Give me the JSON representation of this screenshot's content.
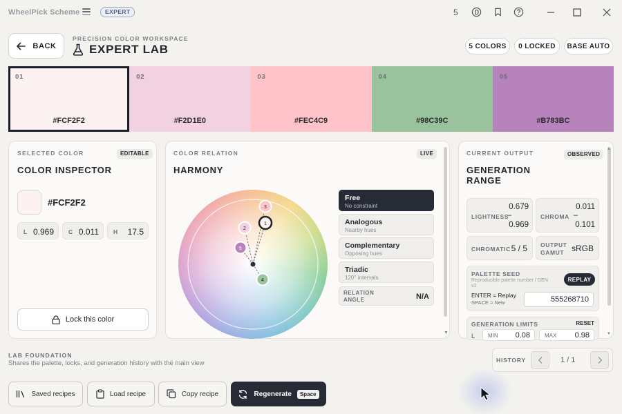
{
  "titlebar": {
    "app_name": "WheelPick Scheme",
    "mode_badge": "EXPERT",
    "counter": "5",
    "icons": [
      "menu-icon",
      "currency-icon",
      "bookmark-icon",
      "help-icon",
      "minimize-icon",
      "maximize-icon",
      "close-icon"
    ]
  },
  "header": {
    "back_label": "BACK",
    "kicker": "PRECISION COLOR WORKSPACE",
    "title": "EXPERT LAB",
    "chips": [
      "5 COLORS",
      "0 LOCKED",
      "BASE AUTO"
    ]
  },
  "swatches": [
    {
      "index": "01",
      "hex": "#FCF2F2",
      "color": "#FCF2F2",
      "selected": true
    },
    {
      "index": "02",
      "hex": "#F2D1E0",
      "color": "#F2D1E0",
      "selected": false
    },
    {
      "index": "03",
      "hex": "#FEC4C9",
      "color": "#FEC4C9",
      "selected": false
    },
    {
      "index": "04",
      "hex": "#98C39C",
      "color": "#98C39C",
      "selected": false
    },
    {
      "index": "05",
      "hex": "#B783BC",
      "color": "#B783BC",
      "selected": false
    }
  ],
  "inspector": {
    "kicker": "SELECTED COLOR",
    "tag": "EDITABLE",
    "title": "COLOR INSPECTOR",
    "hex": "#FCF2F2",
    "preview_color": "#FCF2F2",
    "l_label": "L",
    "l_value": "0.969",
    "c_label": "C",
    "c_value": "0.011",
    "h_label": "H",
    "h_value": "17.5",
    "lock_label": "Lock this color"
  },
  "relation": {
    "kicker": "COLOR RELATION",
    "tag": "LIVE",
    "title": "HARMONY",
    "wheel_points": [
      "1",
      "2",
      "3",
      "4",
      "5"
    ],
    "options": [
      {
        "title": "Free",
        "subtitle": "No constraint",
        "active": true
      },
      {
        "title": "Analogous",
        "subtitle": "Nearby hues",
        "active": false
      },
      {
        "title": "Complementary",
        "subtitle": "Opposing hues",
        "active": false
      },
      {
        "title": "Triadic",
        "subtitle": "120° intervals",
        "active": false
      }
    ],
    "angle_label_1": "RELATION",
    "angle_label_2": "ANGLE",
    "angle_value": "N/A"
  },
  "output": {
    "kicker": "CURRENT OUTPUT",
    "tag": "OBSERVED",
    "title_1": "GENERATION",
    "title_2": "RANGE",
    "lightness_label": "LIGHTNESS",
    "lightness_min": "0.679",
    "lightness_max": "0.969",
    "chroma_label": "CHROMA",
    "chroma_min": "0.011",
    "chroma_max": "0.101",
    "dash": "–",
    "chromatic_label": "CHROMATIC",
    "chromatic_value": "5 / 5",
    "gamut_label_1": "OUTPUT",
    "gamut_label_2": "GAMUT",
    "gamut_value": "sRGB",
    "seed_label": "PALETTE SEED",
    "seed_desc_1": "Reproducible palette number / GEN",
    "seed_desc_2": "v2",
    "replay_label": "REPLAY",
    "enter_hint": "ENTER = Replay",
    "space_hint": "SPACE = New",
    "seed_value": "555268710",
    "limits_label": "GENERATION LIMITS",
    "reset_label": "RESET",
    "l_label": "L",
    "min_label": "MIN",
    "min_value": "0.08",
    "max_label": "MAX",
    "max_value": "0.98"
  },
  "foundation": {
    "title": "LAB FOUNDATION",
    "desc": "Shares the palette, locks, and generation history with the main view"
  },
  "history": {
    "label": "HISTORY",
    "page": "1 / 1"
  },
  "footer": {
    "saved": "Saved recipes",
    "load": "Load recipe",
    "copy": "Copy recipe",
    "regen": "Regenerate",
    "regen_key": "Space"
  }
}
